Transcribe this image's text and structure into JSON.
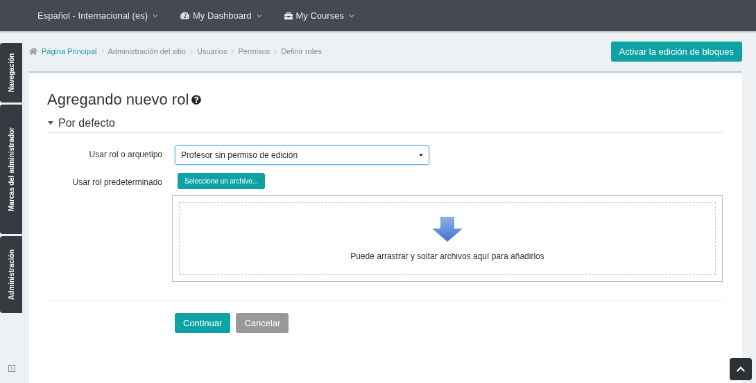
{
  "navbar": {
    "items": [
      {
        "label": "Español - Internacional (es)",
        "kind": "plain"
      },
      {
        "label": "My Dashboard",
        "kind": "dashboard"
      },
      {
        "label": "My Courses",
        "kind": "courses"
      }
    ]
  },
  "side_tabs": [
    {
      "label": "Navegación"
    },
    {
      "label": "Marcas del administrador"
    },
    {
      "label": "Administración"
    }
  ],
  "breadcrumb": [
    {
      "label": "Página Principal",
      "kind": "home"
    },
    {
      "label": "Administración del sitio",
      "kind": "plain"
    },
    {
      "label": "Usuarios",
      "kind": "plain"
    },
    {
      "label": "Permisos",
      "kind": "plain"
    },
    {
      "label": "Definir roles",
      "kind": "plain"
    }
  ],
  "edit_button": "Activar la edición de bloques",
  "page_title": "Agregando nuevo rol",
  "section": {
    "title": "Por defecto",
    "expanded": true
  },
  "form": {
    "archetype_label": "Usar rol o arquetipo",
    "archetype_value": "Profesor sin permiso de edición",
    "preset_label": "Usar rol predeterminado",
    "file_button": "Seleccione un archivo...",
    "drop_text": "Puede arrastrar y soltar archivos aquí para añadirlos"
  },
  "actions": [
    {
      "label": "Continuar",
      "kind": "primary"
    },
    {
      "label": "Cancelar",
      "kind": "secondary"
    }
  ]
}
